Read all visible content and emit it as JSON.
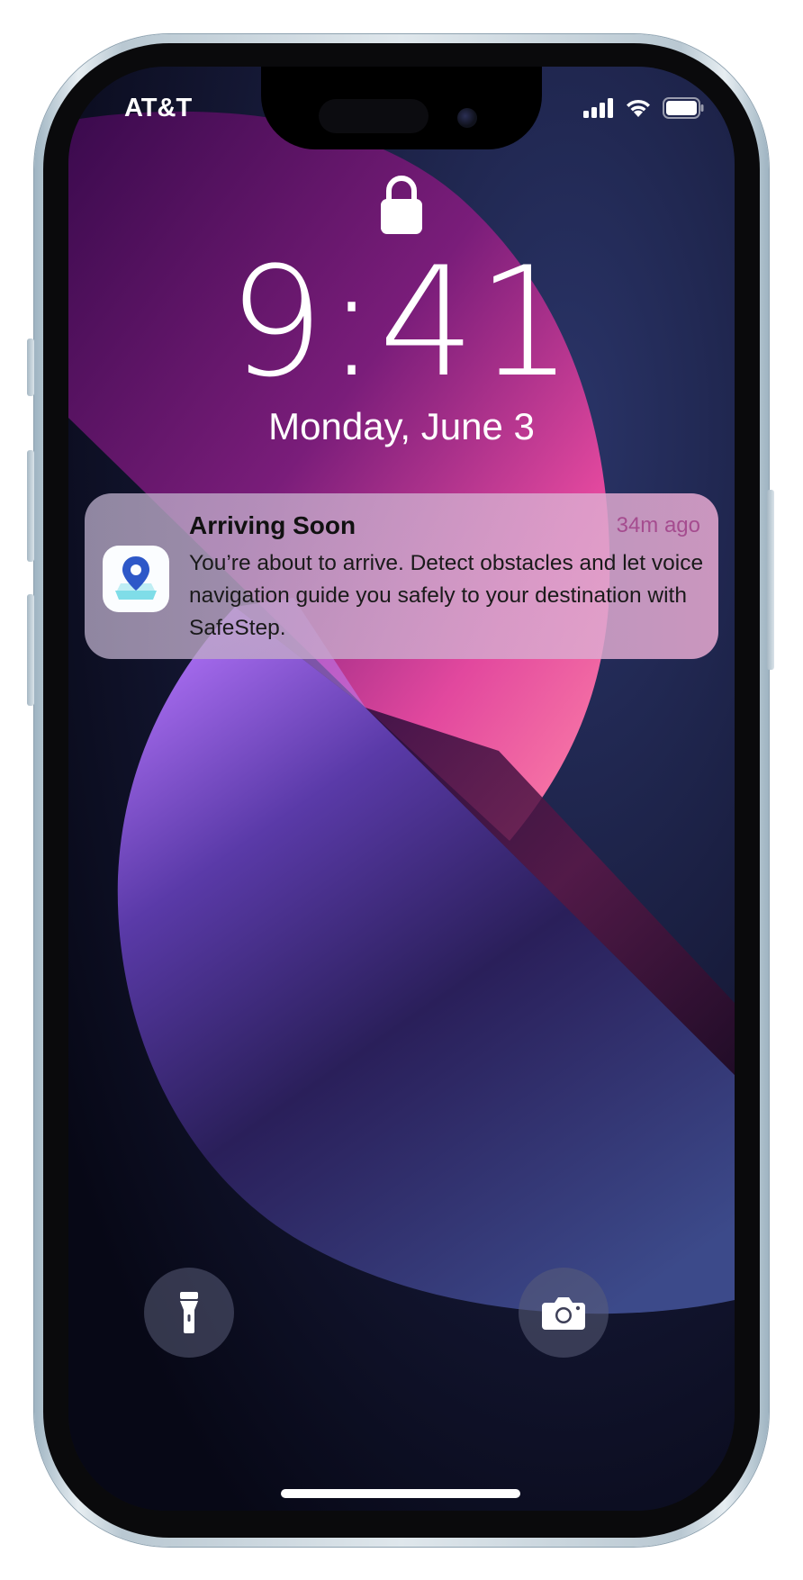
{
  "status_bar": {
    "carrier": "AT&T",
    "icons": [
      "signal-icon",
      "wifi-icon",
      "battery-icon"
    ]
  },
  "lock_screen": {
    "lock_icon": "lock-icon",
    "time": "9:41",
    "date": "Monday, June 3"
  },
  "notification": {
    "app_icon": "safestep-map-pin-icon",
    "title": "Arriving Soon",
    "time_ago": "34m ago",
    "body": "You’re about to arrive. Detect obstacles and let voice navigation guide you safely to your destination with SafeStep."
  },
  "quick_actions": {
    "left": "flashlight-icon",
    "right": "camera-icon"
  },
  "colors": {
    "accent_time": "#a54c8f",
    "pin_blue": "#2e58c8",
    "wallpaper_pink": "#ff5fa8",
    "wallpaper_purple": "#7a3cc0"
  }
}
